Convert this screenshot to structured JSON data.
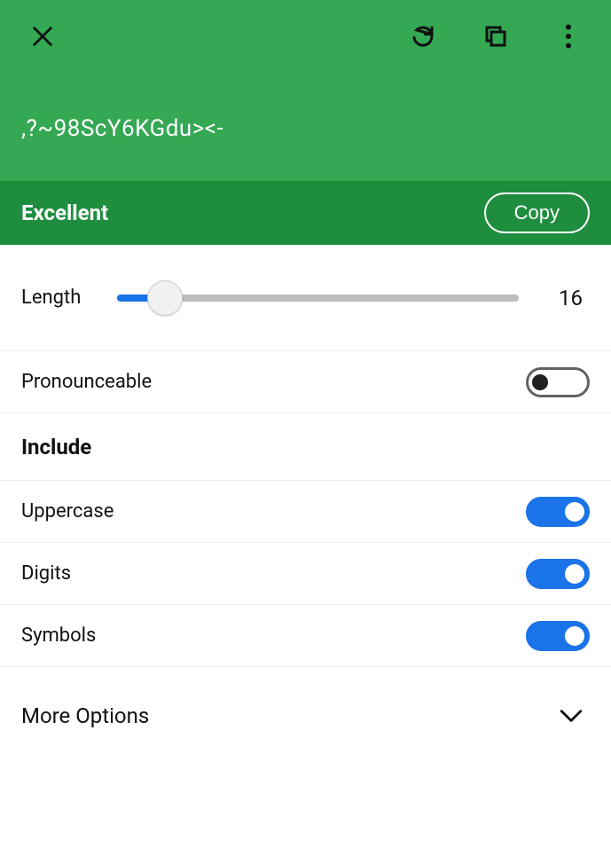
{
  "header": {
    "password": ",?~98ScY6KGdu><-"
  },
  "strength": {
    "label": "Excellent",
    "copy_label": "Copy"
  },
  "length": {
    "label": "Length",
    "value": "16",
    "min": 4,
    "max": 64,
    "fill_percent": 12
  },
  "pronounceable": {
    "label": "Pronounceable",
    "on": false
  },
  "include": {
    "header": "Include",
    "uppercase": {
      "label": "Uppercase",
      "on": true
    },
    "digits": {
      "label": "Digits",
      "on": true
    },
    "symbols": {
      "label": "Symbols",
      "on": true
    }
  },
  "more": {
    "label": "More Options"
  }
}
